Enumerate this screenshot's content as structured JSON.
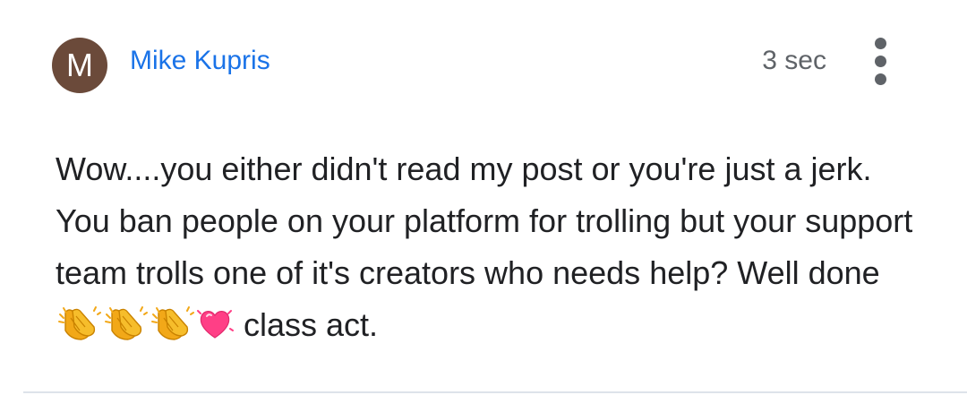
{
  "comment": {
    "avatar_letter": "M",
    "author": "Mike Kupris",
    "timestamp": "3 sec",
    "text_before": "Wow....you either didn't read my post or you're just a jerk. You ban people on your platform for trolling but your support team trolls one of it's creators who needs help? Well done",
    "text_after": " class act.",
    "emojis": [
      "clapping-hands",
      "clapping-hands",
      "clapping-hands",
      "growing-heart"
    ],
    "menu_icon": "more-vertical-icon"
  },
  "colors": {
    "avatar_bg": "#6b4a3a",
    "author_link": "#1a73e8",
    "secondary_text": "#5f6368",
    "body_text": "#202124"
  }
}
